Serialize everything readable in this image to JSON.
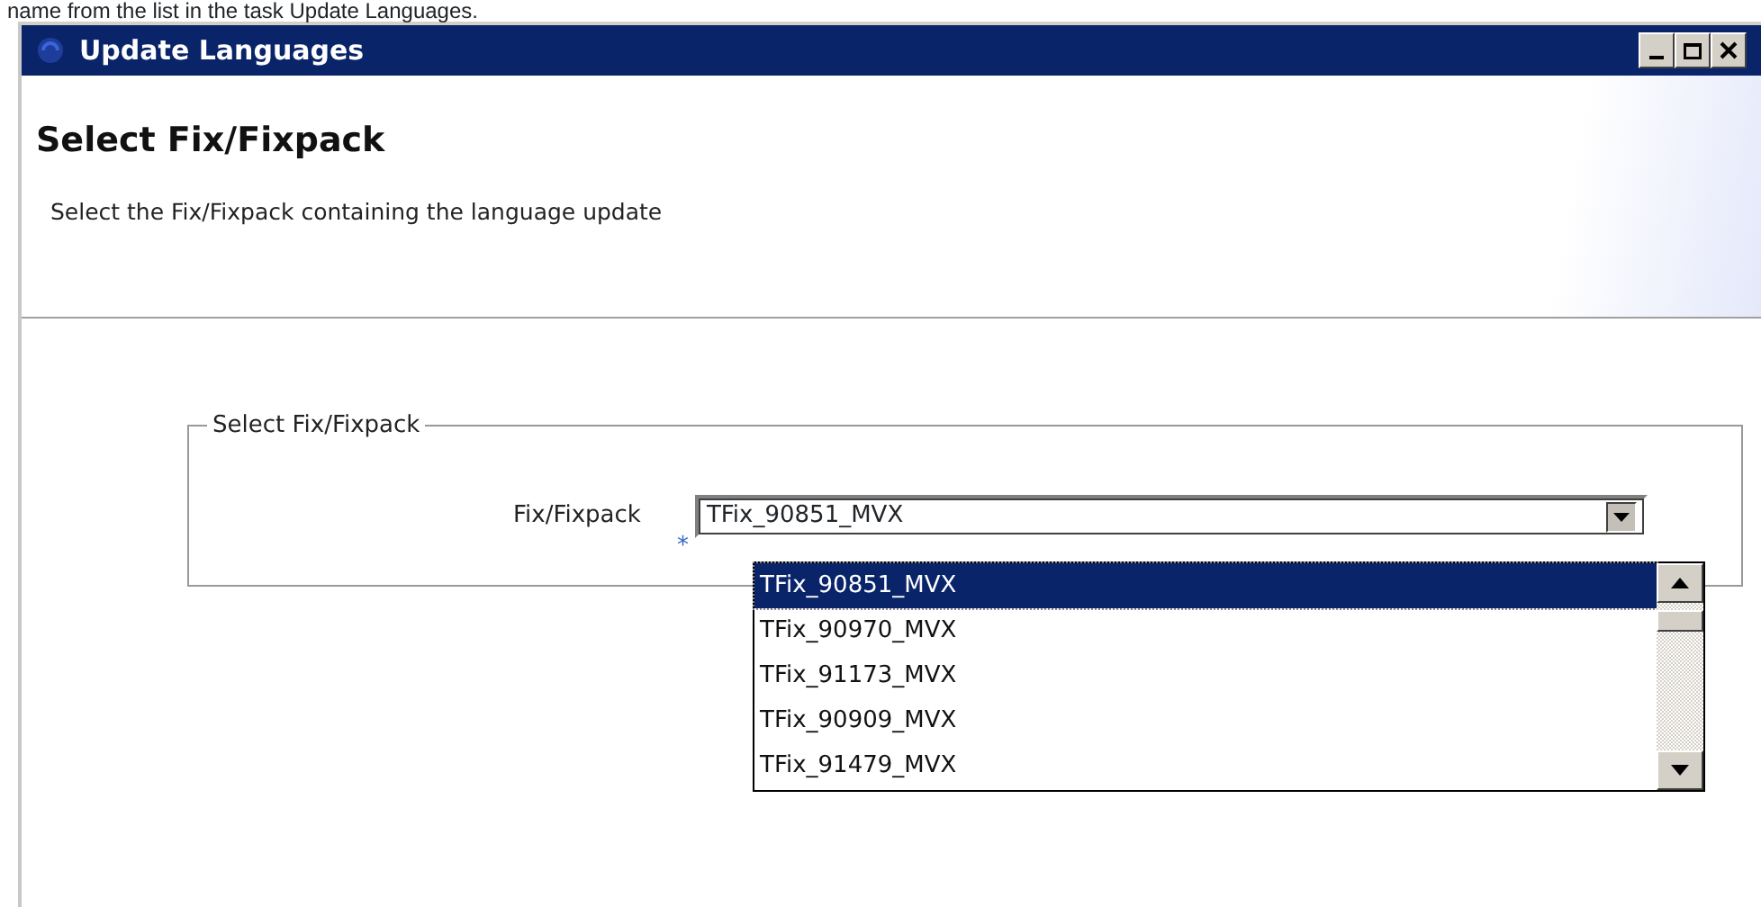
{
  "caption": "name from the list in the task Update Languages.",
  "window": {
    "title": "Update Languages",
    "buttons": [
      {
        "kind": "minimize"
      },
      {
        "kind": "maximize"
      },
      {
        "kind": "close"
      }
    ]
  },
  "header": {
    "title": "Select Fix/Fixpack",
    "description": "Select the Fix/Fixpack containing the language update"
  },
  "group": {
    "legend": "Select Fix/Fixpack",
    "field_label": "Fix/Fixpack",
    "required_mark": "*",
    "value": "TFix_90851_MVX",
    "expanded": true,
    "options": [
      {
        "label": "TFix_90851_MVX",
        "selected": true
      },
      {
        "label": "TFix_90970_MVX",
        "selected": false
      },
      {
        "label": "TFix_91173_MVX",
        "selected": false
      },
      {
        "label": "TFix_90909_MVX",
        "selected": false
      },
      {
        "label": "TFix_91479_MVX",
        "selected": false
      }
    ]
  }
}
